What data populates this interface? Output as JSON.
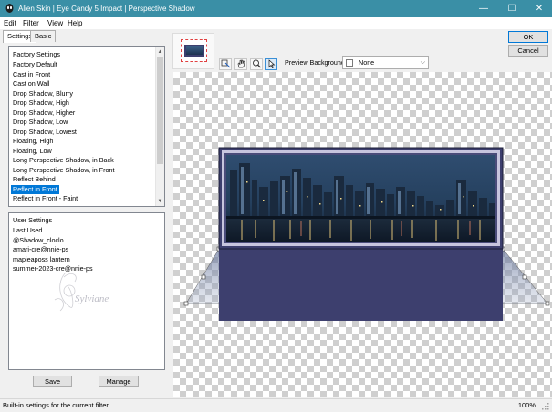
{
  "window": {
    "title": "Alien Skin | Eye Candy 5 Impact | Perspective Shadow",
    "minimize": "—",
    "maximize": "☐",
    "close": "✕"
  },
  "menu": [
    "Edit",
    "Filter",
    "View",
    "Help"
  ],
  "tabs": [
    "Settings",
    "Basic"
  ],
  "factory_settings": {
    "header": "Factory Settings",
    "items": [
      "Factory Default",
      "Cast in Front",
      "Cast on Wall",
      "Drop Shadow, Blurry",
      "Drop Shadow, High",
      "Drop Shadow, Higher",
      "Drop Shadow, Low",
      "Drop Shadow, Lowest",
      "Floating, High",
      "Floating, Low",
      "Long Perspective Shadow, in Back",
      "Long Perspective Shadow, in Front",
      "Reflect Behind",
      "Reflect in Front",
      "Reflect in Front - Faint"
    ],
    "selected": "Reflect in Front"
  },
  "user_settings": {
    "header": "User Settings",
    "items": [
      "Last Used",
      "@Shadow_cloclo",
      "amari-cre@nnie-ps",
      "mapieaposs lantern",
      "summer-2023-cre@nnie-ps"
    ]
  },
  "buttons": {
    "save": "Save",
    "manage": "Manage",
    "ok": "OK",
    "cancel": "Cancel"
  },
  "toolbar": {
    "tools": [
      "transform-icon",
      "hand-icon",
      "zoom-icon",
      "pointer-icon"
    ]
  },
  "preview_background": {
    "label": "Preview Background:",
    "value": "None"
  },
  "status": {
    "text": "Built-in settings for the current filter",
    "zoom": "100%"
  },
  "colors": {
    "titlebar": "#3a8fa6",
    "selection": "#0078d7",
    "frame": "#3d3f6e"
  }
}
